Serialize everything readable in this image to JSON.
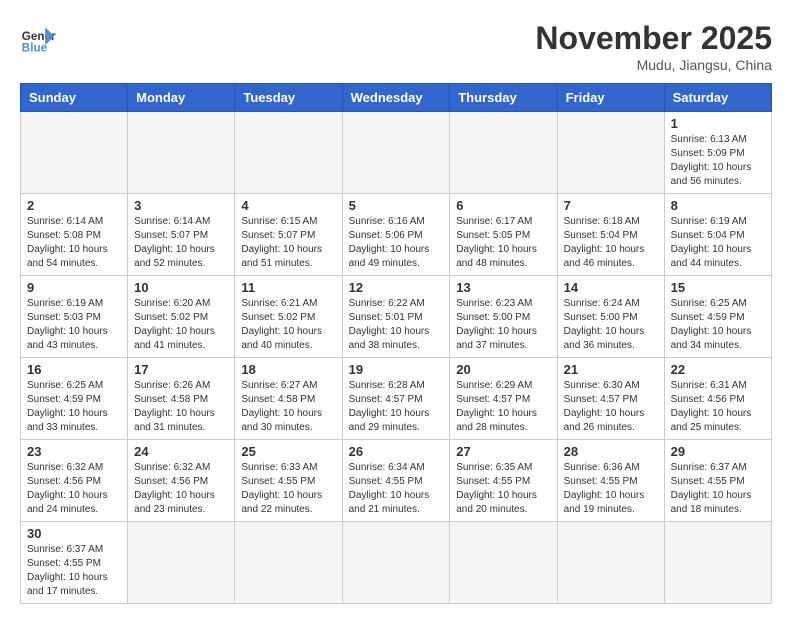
{
  "header": {
    "logo_general": "General",
    "logo_blue": "Blue",
    "month_title": "November 2025",
    "location": "Mudu, Jiangsu, China"
  },
  "weekdays": [
    "Sunday",
    "Monday",
    "Tuesday",
    "Wednesday",
    "Thursday",
    "Friday",
    "Saturday"
  ],
  "weeks": [
    [
      {
        "day": "",
        "info": ""
      },
      {
        "day": "",
        "info": ""
      },
      {
        "day": "",
        "info": ""
      },
      {
        "day": "",
        "info": ""
      },
      {
        "day": "",
        "info": ""
      },
      {
        "day": "",
        "info": ""
      },
      {
        "day": "1",
        "info": "Sunrise: 6:13 AM\nSunset: 5:09 PM\nDaylight: 10 hours and 56 minutes."
      }
    ],
    [
      {
        "day": "2",
        "info": "Sunrise: 6:14 AM\nSunset: 5:08 PM\nDaylight: 10 hours and 54 minutes."
      },
      {
        "day": "3",
        "info": "Sunrise: 6:14 AM\nSunset: 5:07 PM\nDaylight: 10 hours and 52 minutes."
      },
      {
        "day": "4",
        "info": "Sunrise: 6:15 AM\nSunset: 5:07 PM\nDaylight: 10 hours and 51 minutes."
      },
      {
        "day": "5",
        "info": "Sunrise: 6:16 AM\nSunset: 5:06 PM\nDaylight: 10 hours and 49 minutes."
      },
      {
        "day": "6",
        "info": "Sunrise: 6:17 AM\nSunset: 5:05 PM\nDaylight: 10 hours and 48 minutes."
      },
      {
        "day": "7",
        "info": "Sunrise: 6:18 AM\nSunset: 5:04 PM\nDaylight: 10 hours and 46 minutes."
      },
      {
        "day": "8",
        "info": "Sunrise: 6:19 AM\nSunset: 5:04 PM\nDaylight: 10 hours and 44 minutes."
      }
    ],
    [
      {
        "day": "9",
        "info": "Sunrise: 6:19 AM\nSunset: 5:03 PM\nDaylight: 10 hours and 43 minutes."
      },
      {
        "day": "10",
        "info": "Sunrise: 6:20 AM\nSunset: 5:02 PM\nDaylight: 10 hours and 41 minutes."
      },
      {
        "day": "11",
        "info": "Sunrise: 6:21 AM\nSunset: 5:02 PM\nDaylight: 10 hours and 40 minutes."
      },
      {
        "day": "12",
        "info": "Sunrise: 6:22 AM\nSunset: 5:01 PM\nDaylight: 10 hours and 38 minutes."
      },
      {
        "day": "13",
        "info": "Sunrise: 6:23 AM\nSunset: 5:00 PM\nDaylight: 10 hours and 37 minutes."
      },
      {
        "day": "14",
        "info": "Sunrise: 6:24 AM\nSunset: 5:00 PM\nDaylight: 10 hours and 36 minutes."
      },
      {
        "day": "15",
        "info": "Sunrise: 6:25 AM\nSunset: 4:59 PM\nDaylight: 10 hours and 34 minutes."
      }
    ],
    [
      {
        "day": "16",
        "info": "Sunrise: 6:25 AM\nSunset: 4:59 PM\nDaylight: 10 hours and 33 minutes."
      },
      {
        "day": "17",
        "info": "Sunrise: 6:26 AM\nSunset: 4:58 PM\nDaylight: 10 hours and 31 minutes."
      },
      {
        "day": "18",
        "info": "Sunrise: 6:27 AM\nSunset: 4:58 PM\nDaylight: 10 hours and 30 minutes."
      },
      {
        "day": "19",
        "info": "Sunrise: 6:28 AM\nSunset: 4:57 PM\nDaylight: 10 hours and 29 minutes."
      },
      {
        "day": "20",
        "info": "Sunrise: 6:29 AM\nSunset: 4:57 PM\nDaylight: 10 hours and 28 minutes."
      },
      {
        "day": "21",
        "info": "Sunrise: 6:30 AM\nSunset: 4:57 PM\nDaylight: 10 hours and 26 minutes."
      },
      {
        "day": "22",
        "info": "Sunrise: 6:31 AM\nSunset: 4:56 PM\nDaylight: 10 hours and 25 minutes."
      }
    ],
    [
      {
        "day": "23",
        "info": "Sunrise: 6:32 AM\nSunset: 4:56 PM\nDaylight: 10 hours and 24 minutes."
      },
      {
        "day": "24",
        "info": "Sunrise: 6:32 AM\nSunset: 4:56 PM\nDaylight: 10 hours and 23 minutes."
      },
      {
        "day": "25",
        "info": "Sunrise: 6:33 AM\nSunset: 4:55 PM\nDaylight: 10 hours and 22 minutes."
      },
      {
        "day": "26",
        "info": "Sunrise: 6:34 AM\nSunset: 4:55 PM\nDaylight: 10 hours and 21 minutes."
      },
      {
        "day": "27",
        "info": "Sunrise: 6:35 AM\nSunset: 4:55 PM\nDaylight: 10 hours and 20 minutes."
      },
      {
        "day": "28",
        "info": "Sunrise: 6:36 AM\nSunset: 4:55 PM\nDaylight: 10 hours and 19 minutes."
      },
      {
        "day": "29",
        "info": "Sunrise: 6:37 AM\nSunset: 4:55 PM\nDaylight: 10 hours and 18 minutes."
      }
    ],
    [
      {
        "day": "30",
        "info": "Sunrise: 6:37 AM\nSunset: 4:55 PM\nDaylight: 10 hours and 17 minutes."
      },
      {
        "day": "",
        "info": ""
      },
      {
        "day": "",
        "info": ""
      },
      {
        "day": "",
        "info": ""
      },
      {
        "day": "",
        "info": ""
      },
      {
        "day": "",
        "info": ""
      },
      {
        "day": "",
        "info": ""
      }
    ]
  ]
}
